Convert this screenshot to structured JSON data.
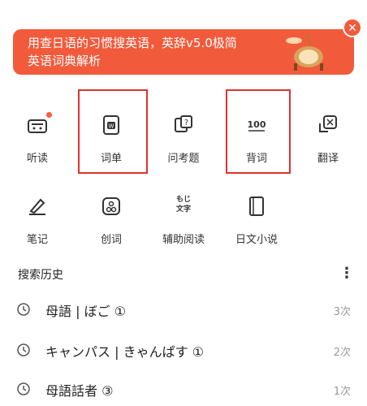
{
  "banner": {
    "line1": "用查日语的习惯搜英语，英辞v5.0极简",
    "line2": "英语词典解析",
    "close": "✕"
  },
  "menu_row1": [
    {
      "label": "听读",
      "icon": "radio-icon"
    },
    {
      "label": "词单",
      "icon": "wordbook-icon"
    },
    {
      "label": "问考题",
      "icon": "question-icon"
    },
    {
      "label": "背词",
      "icon": "hundred-icon"
    },
    {
      "label": "翻译",
      "icon": "translate-icon"
    }
  ],
  "menu_row2": [
    {
      "label": "笔记",
      "icon": "pen-icon"
    },
    {
      "label": "创词",
      "icon": "create-word-icon"
    },
    {
      "label": "辅助阅读",
      "icon": "moji-icon",
      "icon_text_top": "もじ",
      "icon_text_bottom": "文字"
    },
    {
      "label": "日文小说",
      "icon": "book-icon"
    }
  ],
  "hundred_icon_text": "100",
  "history": {
    "title": "搜索历史",
    "more": "⋮",
    "items": [
      {
        "word": "母語 | ぼご ①",
        "count": "3次"
      },
      {
        "word": "キャンパス | きゃんぱす ①",
        "count": "2次"
      },
      {
        "word": "母語話者 ③",
        "count": "1次"
      }
    ]
  },
  "colors": {
    "banner_bg": "#f25a3c",
    "highlight": "#e0322c"
  }
}
